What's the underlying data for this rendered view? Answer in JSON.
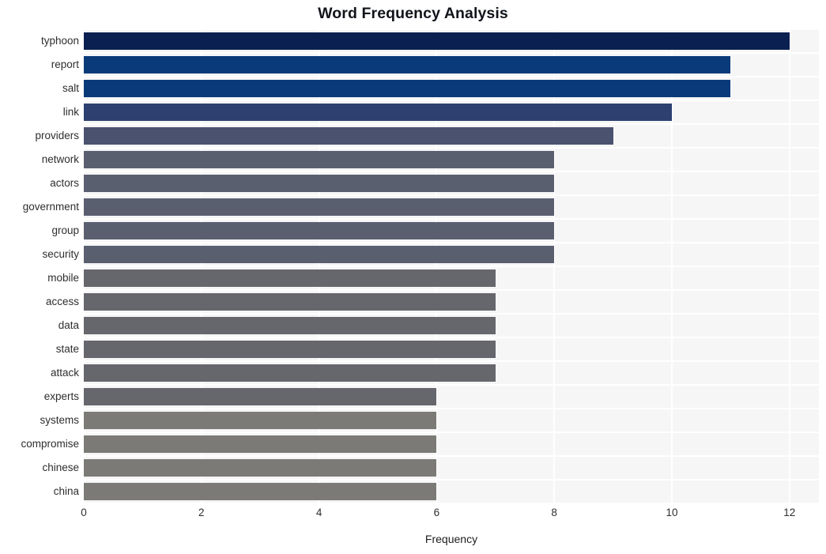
{
  "chart_data": {
    "type": "bar",
    "orientation": "horizontal",
    "title": "Word Frequency Analysis",
    "xlabel": "Frequency",
    "ylabel": "",
    "xlim": [
      0,
      12.5
    ],
    "xticks": [
      0,
      2,
      4,
      6,
      8,
      10,
      12
    ],
    "xticklabels": [
      "0",
      "2",
      "4",
      "6",
      "8",
      "10",
      "12"
    ],
    "grid": true,
    "legend": null,
    "categories": [
      "typhoon",
      "report",
      "salt",
      "link",
      "providers",
      "network",
      "actors",
      "government",
      "group",
      "security",
      "mobile",
      "access",
      "data",
      "state",
      "attack",
      "experts",
      "systems",
      "compromise",
      "chinese",
      "china"
    ],
    "values": [
      12,
      11,
      11,
      10,
      9,
      8,
      8,
      8,
      8,
      8,
      7,
      7,
      7,
      7,
      7,
      6,
      6,
      6,
      6,
      6
    ],
    "bar_colors": [
      "#0a2050",
      "#0a3a7a",
      "#0a3a7a",
      "#2d4070",
      "#4a5270",
      "#5a5f70",
      "#5a5f70",
      "#5a5f70",
      "#5a5f70",
      "#5a5f70",
      "#66666d",
      "#66666d",
      "#66666d",
      "#66666d",
      "#66666d",
      "#66666d",
      "#7b7a76",
      "#7b7a76",
      "#7b7a76",
      "#7b7a76"
    ]
  },
  "style": {
    "plot_background": "#f6f6f7",
    "gridline_color": "#ffffff",
    "title_color": "#11141a",
    "tick_label_color": "#2e2e2e",
    "figure_background": "#ffffff"
  }
}
